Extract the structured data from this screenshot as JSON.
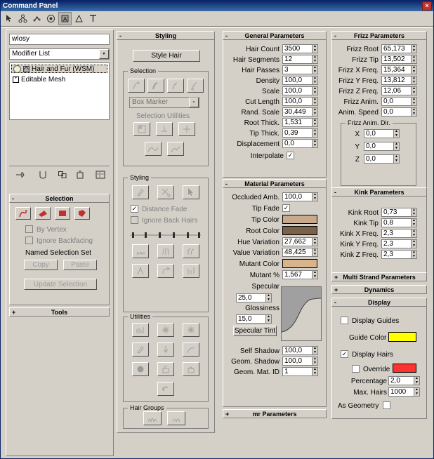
{
  "window": {
    "title": "Command Panel",
    "close_label": "×"
  },
  "toolbar": {
    "icons": [
      "cursor-icon",
      "hierarchy-icon",
      "motion-icon",
      "display-icon",
      "utilities-icon",
      "create-icon",
      "modify-icon"
    ]
  },
  "object": {
    "name_value": "wlosy",
    "modifier_list_label": "Modifier List",
    "stack": [
      {
        "label": "Hair and Fur (WSM)",
        "selected": true
      },
      {
        "label": "Editable Mesh",
        "selected": false
      }
    ]
  },
  "stack_tools": [
    "pin-stack-icon",
    "show-end-result-icon",
    "make-unique-icon",
    "remove-modifier-icon",
    "configure-sets-icon"
  ],
  "selection_rollout": {
    "title": "Selection",
    "by_vertex": "By Vertex",
    "ignore_backfacing": "Ignore Backfacing",
    "named_selection_set": "Named Selection Set",
    "copy": "Copy",
    "paste": "Paste",
    "update_selection": "Update Selection"
  },
  "tools_rollout": {
    "title": "Tools"
  },
  "styling_rollout": {
    "title": "Styling",
    "style_hair_button": "Style Hair",
    "selection_group": "Selection",
    "box_marker": "Box Marker",
    "selection_utilities": "Selection Utilities",
    "styling_group": "Styling",
    "distance_fade": "Distance Fade",
    "ignore_back_hairs": "Ignore Back Hairs",
    "utilities_group": "Utilities",
    "hair_groups_group": "Hair Groups"
  },
  "general_parameters": {
    "title": "General Parameters",
    "fields": [
      {
        "label": "Hair Count",
        "value": "3500"
      },
      {
        "label": "Hair Segments",
        "value": "12"
      },
      {
        "label": "Hair Passes",
        "value": "3"
      },
      {
        "label": "Density",
        "value": "100,0"
      },
      {
        "label": "Scale",
        "value": "100,0"
      },
      {
        "label": "Cut Length",
        "value": "100,0"
      },
      {
        "label": "Rand. Scale",
        "value": "30,449"
      },
      {
        "label": "Root Thick.",
        "value": "1,531"
      },
      {
        "label": "Tip Thick.",
        "value": "0,39"
      },
      {
        "label": "Displacement",
        "value": "0,0"
      }
    ],
    "interpolate_label": "Interpolate",
    "interpolate_checked": true
  },
  "material_parameters": {
    "title": "Material Parameters",
    "occluded_amb": {
      "label": "Occluded Amb.",
      "value": "100,0"
    },
    "tip_fade": {
      "label": "Tip Fade",
      "checked": true
    },
    "tip_color": {
      "label": "Tip Color",
      "color": "#c8a98c"
    },
    "root_color": {
      "label": "Root Color",
      "color": "#7a6149"
    },
    "hue_variation": {
      "label": "Hue Variation",
      "value": "27,662"
    },
    "value_variation": {
      "label": "Value Variation",
      "value": "48,425"
    },
    "mutant_color": {
      "label": "Mutant Color",
      "color": "#d8b48c"
    },
    "mutant_pct": {
      "label": "Mutant %",
      "value": "1,567"
    },
    "specular": {
      "label": "Specular",
      "value": "25,0"
    },
    "glossiness": {
      "label": "Glossiness",
      "value": "15,0"
    },
    "specular_tint": {
      "label": "Specular Tint"
    },
    "self_shadow": {
      "label": "Self Shadow",
      "value": "100,0"
    },
    "geom_shadow": {
      "label": "Geom. Shadow",
      "value": "100,0"
    },
    "geom_mat_id": {
      "label": "Geom. Mat. ID",
      "value": "1"
    }
  },
  "mr_parameters": {
    "title": "mr Parameters"
  },
  "frizz_parameters": {
    "title": "Frizz Parameters",
    "fields": [
      {
        "label": "Frizz Root",
        "value": "65,173"
      },
      {
        "label": "Frizz Tip",
        "value": "13,502"
      },
      {
        "label": "Frizz X Freq.",
        "value": "15,364"
      },
      {
        "label": "Frizz Y Freq.",
        "value": "13,812"
      },
      {
        "label": "Frizz Z Freq.",
        "value": "12,06"
      },
      {
        "label": "Frizz Anim.",
        "value": "0,0"
      },
      {
        "label": "Anim. Speed",
        "value": "0,0"
      }
    ],
    "anim_dir_group": "Frizz Anim. Dir.",
    "anim_dir": [
      {
        "label": "X",
        "value": "0,0"
      },
      {
        "label": "Y",
        "value": "0,0"
      },
      {
        "label": "Z",
        "value": "0,0"
      }
    ]
  },
  "kink_parameters": {
    "title": "Kink Parameters",
    "fields": [
      {
        "label": "Kink Root",
        "value": "0,73"
      },
      {
        "label": "Kink Tip",
        "value": "0,8"
      },
      {
        "label": "Kink X Freq.",
        "value": "2,3"
      },
      {
        "label": "Kink Y Freq.",
        "value": "2,3"
      },
      {
        "label": "Kink Z Freq.",
        "value": "2,3"
      }
    ]
  },
  "multi_strand_parameters": {
    "title": "Multi Strand Parameters"
  },
  "dynamics": {
    "title": "Dynamics"
  },
  "display": {
    "title": "Display",
    "display_guides": {
      "label": "Display Guides",
      "checked": false
    },
    "guide_color": {
      "label": "Guide Color",
      "color": "#ffff00"
    },
    "display_hairs": {
      "label": "Display Hairs",
      "checked": true
    },
    "override": {
      "label": "Override",
      "checked": false,
      "color": "#ff3030"
    },
    "percentage": {
      "label": "Percentage",
      "value": "2,0"
    },
    "max_hairs": {
      "label": "Max. Hairs",
      "value": "1000"
    },
    "as_geometry": {
      "label": "As Geometry",
      "checked": false
    }
  }
}
